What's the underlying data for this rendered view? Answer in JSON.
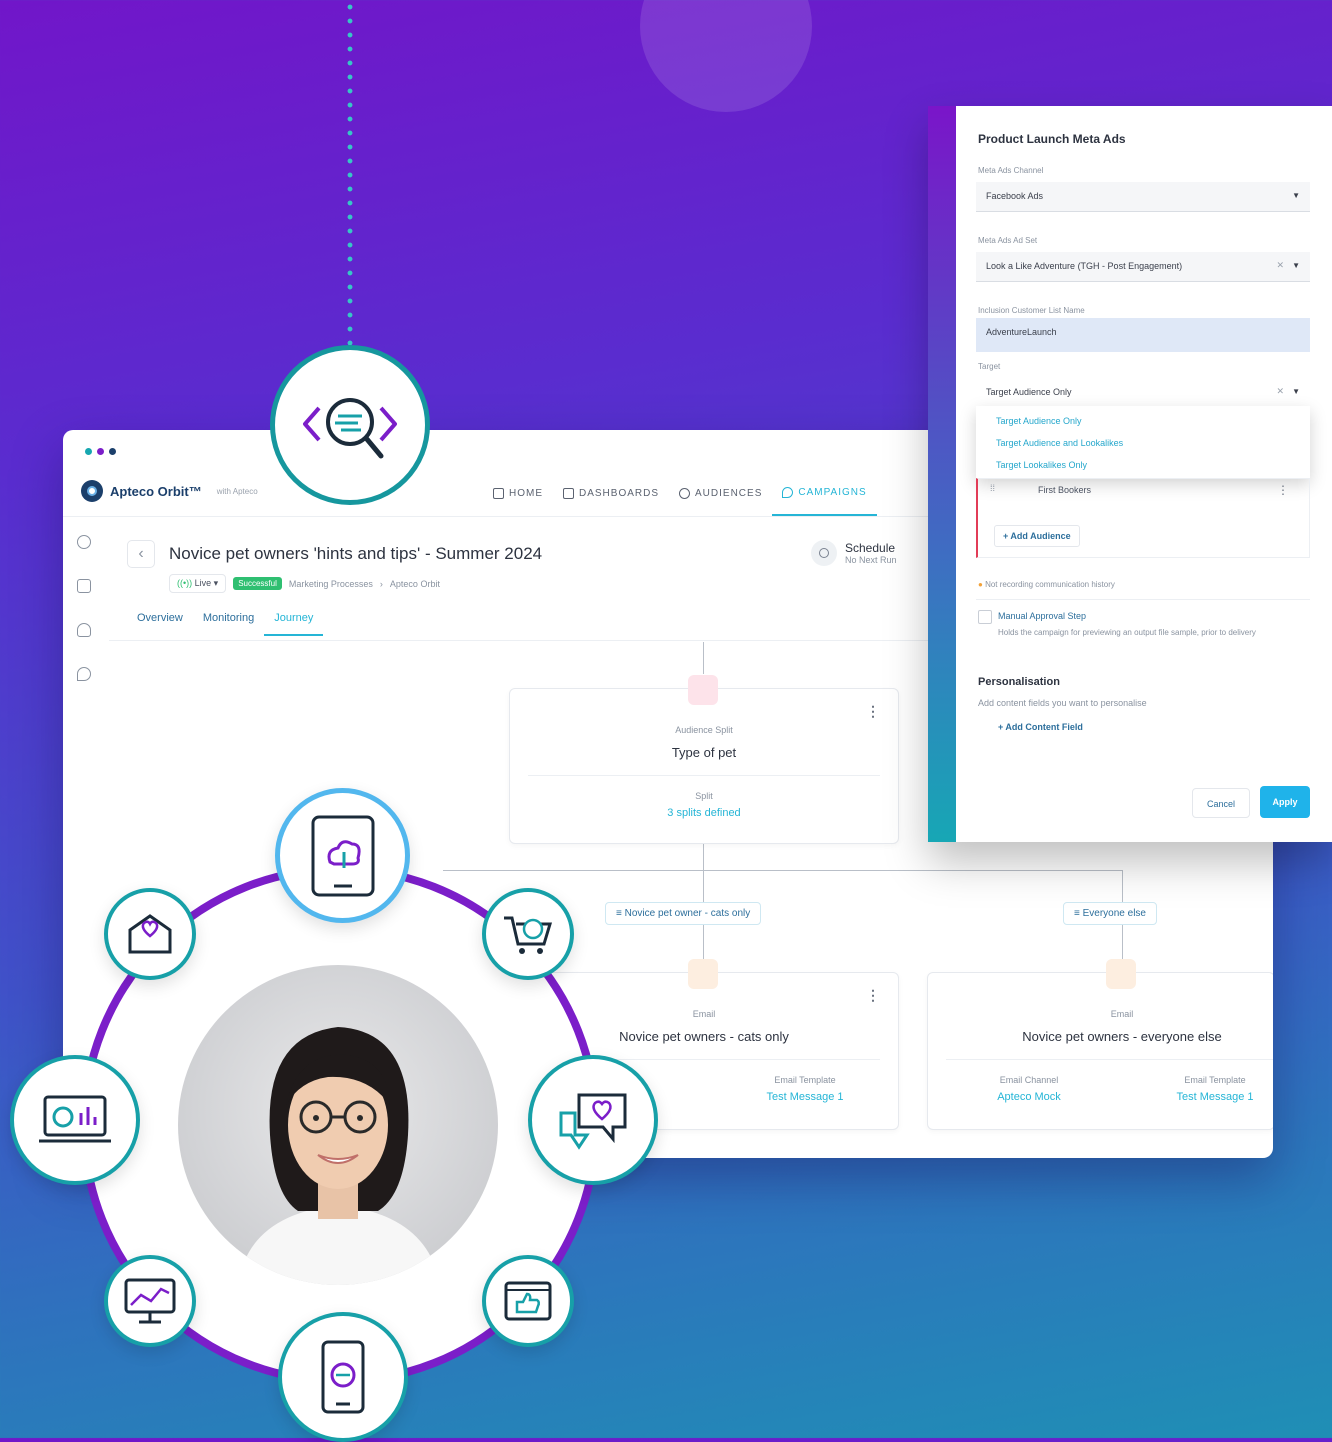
{
  "app": {
    "brand": "Apteco Orbit™",
    "brand_sub": "with Apteco",
    "nav": [
      {
        "label": "HOME",
        "icon": "home-icon"
      },
      {
        "label": "DASHBOARDS",
        "icon": "dashboard-icon"
      },
      {
        "label": "AUDIENCES",
        "icon": "audiences-icon"
      },
      {
        "label": "CAMPAIGNS",
        "icon": "campaigns-icon",
        "active": true
      }
    ]
  },
  "campaign": {
    "title": "Novice pet owners 'hints and tips' - Summer 2024",
    "status": "Live",
    "badge": "Successful",
    "breadcrumb_1": "Marketing Processes",
    "breadcrumb_sep": "›",
    "breadcrumb_2": "Apteco Orbit",
    "schedule_title": "Schedule",
    "schedule_sub": "No Next Run",
    "tabs": [
      "Overview",
      "Monitoring",
      "Journey"
    ]
  },
  "journey": {
    "split": {
      "label": "Audience Split",
      "title": "Type of pet",
      "sub_label": "Split",
      "link": "3 splits defined"
    },
    "branches": [
      "Novice pet owner - cats only",
      "Everyone else"
    ],
    "email1": {
      "label": "Email",
      "title": "Novice pet owners - cats only",
      "template_label": "Email Template",
      "template": "Test Message 1"
    },
    "email2": {
      "label": "Email",
      "title": "Novice pet owners - everyone else",
      "channel_label": "Email Channel",
      "channel": "Apteco Mock",
      "template_label": "Email Template",
      "template": "Test Message 1"
    }
  },
  "panel": {
    "title": "Product Launch Meta Ads",
    "channel_label": "Meta Ads Channel",
    "channel_value": "Facebook Ads",
    "adset_label": "Meta Ads Ad Set",
    "adset_value": "Look a Like Adventure (TGH - Post Engagement)",
    "inclusion_label": "Inclusion Customer List Name",
    "inclusion_value": "AdventureLaunch",
    "target_label": "Target",
    "target_value": "Target Audience Only",
    "target_options": [
      "Target Audience Only",
      "Target Audience and Lookalikes",
      "Target Lookalikes Only"
    ],
    "audience_item": "First Bookers",
    "add_audience": "+ Add Audience",
    "history_note": "Not recording communication history",
    "approval_title": "Manual Approval Step",
    "approval_desc": "Holds the campaign for previewing an output file sample, prior to delivery",
    "personalisation_title": "Personalisation",
    "personalisation_desc": "Add content fields you want to personalise",
    "add_content": "+ Add Content Field",
    "cancel": "Cancel",
    "apply": "Apply"
  },
  "colors": {
    "accent": "#25b5d6",
    "purple": "#7b1ec9",
    "teal": "#17a0a8",
    "success": "#2fbf71"
  }
}
